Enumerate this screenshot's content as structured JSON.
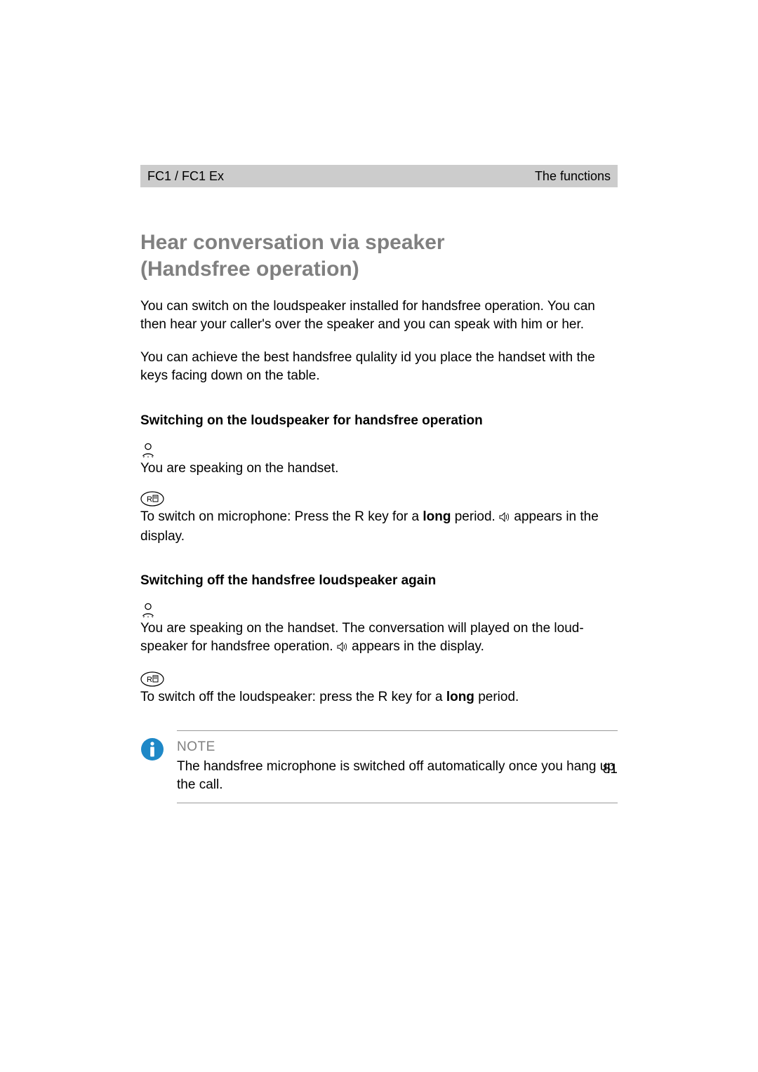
{
  "header": {
    "left": "FC1 / FC1 Ex",
    "right": "The functions"
  },
  "title_line1": "Hear conversation via speaker",
  "title_line2": "(Handsfree operation)",
  "intro1": "You can switch on the loudspeaker installed for handsfree operation. You can then hear your caller's over the speaker and you can speak with him or her.",
  "intro2": "You can achieve the best handsfree qulality id you place the handset with the keys facing down on the table.",
  "sub1": "Switching on the loudspeaker for handsfree operation",
  "sub1_step1": "You are speaking on the handset.",
  "sub1_step2_a": "To switch on microphone: Press the R key for a ",
  "sub1_step2_bold": "long",
  "sub1_step2_b": " period. ",
  "sub1_step2_c": " appears in the display.",
  "sub2": "Switching off the handsfree loudspeaker again",
  "sub2_step1_a": "You are speaking on the handset. The conversation will played on the loud-speaker for handsfree operation. ",
  "sub2_step1_b": " appears in the display.",
  "sub2_step2_a": "To switch off the loudspeaker: press the R key for a ",
  "sub2_step2_bold": "long",
  "sub2_step2_b": " period.",
  "note_label": "NOTE",
  "note_text": "The handsfree microphone is switched off automatically once you hang up the call.",
  "page_number": "81"
}
